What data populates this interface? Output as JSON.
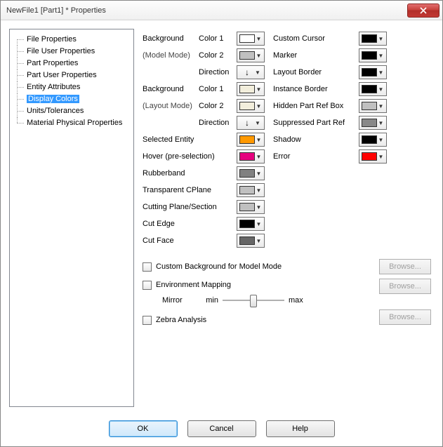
{
  "window": {
    "title": "NewFile1 [Part1] * Properties"
  },
  "tree": {
    "items": [
      {
        "label": "File Properties",
        "selected": false
      },
      {
        "label": "File User Properties",
        "selected": false
      },
      {
        "label": "Part Properties",
        "selected": false
      },
      {
        "label": "Part User Properties",
        "selected": false
      },
      {
        "label": "Entity Attributes",
        "selected": false
      },
      {
        "label": "Display Colors",
        "selected": true
      },
      {
        "label": "Units/Tolerances",
        "selected": false
      },
      {
        "label": "Material Physical Properties",
        "selected": false
      }
    ]
  },
  "labels": {
    "bg_model": "Background",
    "bg_model_sub": "(Model Mode)",
    "bg_layout": "Background",
    "bg_layout_sub": "(Layout Mode)",
    "color1": "Color 1",
    "color2": "Color 2",
    "direction": "Direction",
    "selected_entity": "Selected Entity",
    "hover": "Hover (pre-selection)",
    "rubberband": "Rubberband",
    "transparent_cplane": "Transparent CPlane",
    "cutting_plane": "Cutting Plane/Section",
    "cut_edge": "Cut Edge",
    "cut_face": "Cut Face",
    "custom_cursor": "Custom Cursor",
    "marker": "Marker",
    "layout_border": "Layout Border",
    "instance_border": "Instance Border",
    "hidden_part_ref": "Hidden Part Ref Box",
    "suppressed_part_ref": "Suppressed Part Ref",
    "shadow": "Shadow",
    "error": "Error",
    "custom_bg_cb": "Custom Background for Model Mode",
    "env_mapping_cb": "Environment Mapping",
    "mirror": "Mirror",
    "min": "min",
    "max": "max",
    "zebra_cb": "Zebra Analysis",
    "browse": "Browse..."
  },
  "colors": {
    "bg_model_c1": "#ffffff",
    "bg_model_c2": "#c0c0c0",
    "bg_layout_c1": "#f2eedc",
    "bg_layout_c2": "#f2eedc",
    "selected_entity": "#ff9900",
    "hover": "#e6007e",
    "rubberband": "#808080",
    "transparent_cplane": "#c0c0c0",
    "cutting_plane": "#c0c0c0",
    "cut_edge": "#000000",
    "cut_face": "#666666",
    "custom_cursor": "#000000",
    "marker": "#000000",
    "layout_border": "#000000",
    "instance_border": "#000000",
    "hidden_part_ref": "#c0c0c0",
    "suppressed_part_ref": "#888888",
    "shadow": "#000000",
    "error": "#ff0000"
  },
  "buttons": {
    "ok": "OK",
    "cancel": "Cancel",
    "help": "Help"
  }
}
